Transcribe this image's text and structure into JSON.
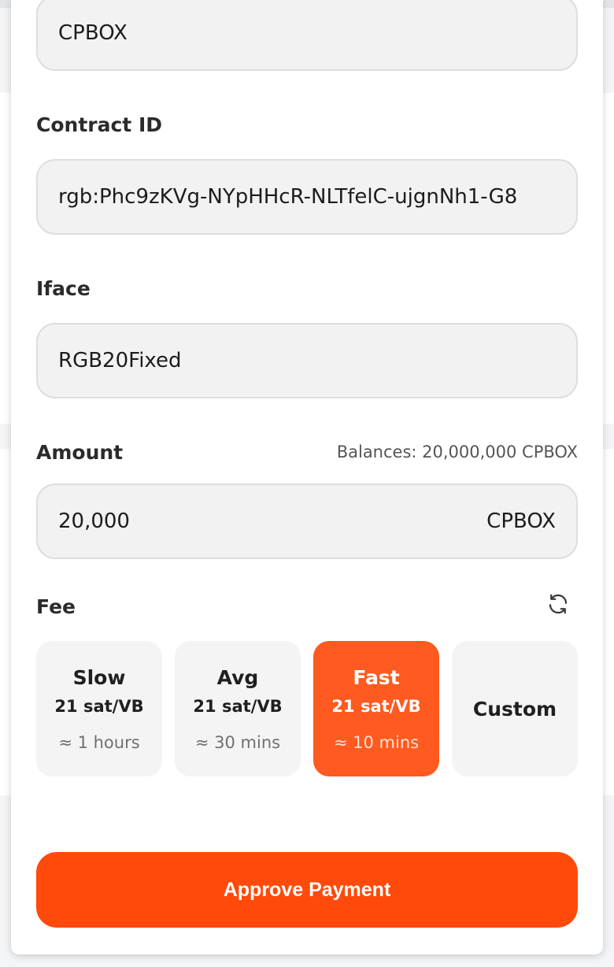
{
  "form": {
    "asset_value": "CPBOX",
    "contract_label": "Contract ID",
    "contract_value": "rgb:Phc9zKVg-NYpHHcR-NLTfelC-ujgnNh1-G8",
    "iface_label": "Iface",
    "iface_value": "RGB20Fixed",
    "amount_label": "Amount",
    "balance_text": "Balances: 20,000,000 CPBOX",
    "amount_value": "20,000",
    "amount_unit": "CPBOX",
    "fee_label": "Fee"
  },
  "fees": [
    {
      "name": "Slow",
      "rate": "21 sat/VB",
      "eta": "≈ 1 hours"
    },
    {
      "name": "Avg",
      "rate": "21 sat/VB",
      "eta": "≈ 30 mins"
    },
    {
      "name": "Fast",
      "rate": "21 sat/VB",
      "eta": "≈ 10 mins"
    },
    {
      "name": "Custom"
    }
  ],
  "selected_fee": "Fast",
  "approve_label": "Approve Payment",
  "colors": {
    "accent": "#ff4a0c",
    "selected_fee": "#ff5a1f",
    "field_bg": "#f2f2f2"
  },
  "icons": {
    "refresh": "refresh-icon"
  }
}
